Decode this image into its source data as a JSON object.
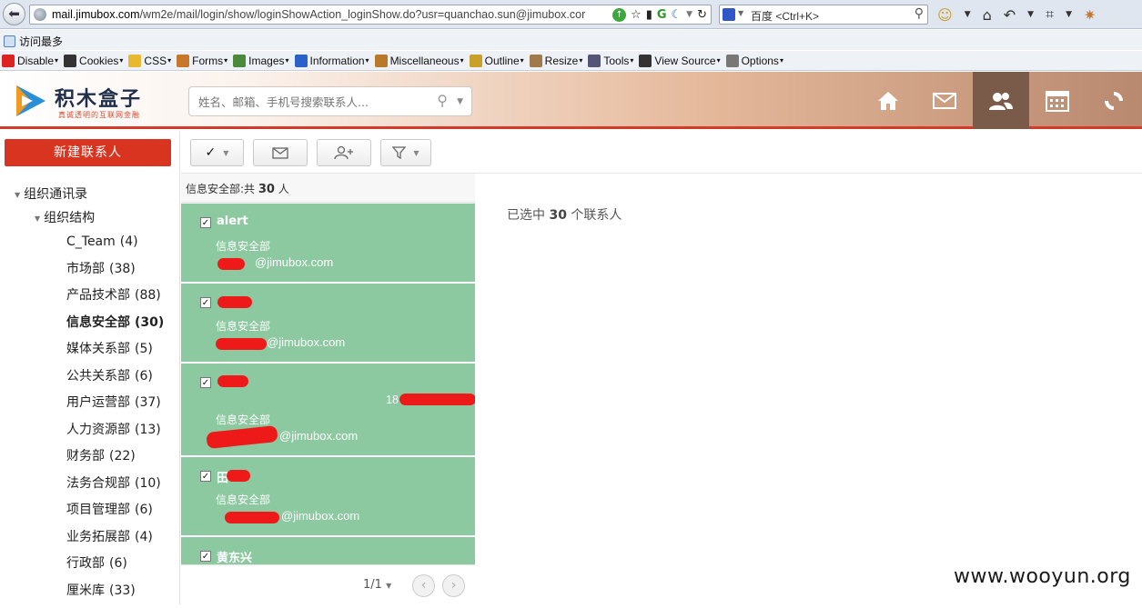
{
  "browser": {
    "url_host": "mail.jimubox.com",
    "url_path": "/wm2e/mail/login/show/loginShowAction_loginShow.do?usr=quanchao.sun@jimubox.cor",
    "search_placeholder": "百度 <Ctrl+K>",
    "bookmark": "访问最多",
    "devbar": [
      {
        "label": "Disable",
        "icon": "disable-icon",
        "color": "#d22"
      },
      {
        "label": "Cookies",
        "icon": "cookies-icon",
        "color": "#333"
      },
      {
        "label": "CSS",
        "icon": "css-icon",
        "color": "#e8b830"
      },
      {
        "label": "Forms",
        "icon": "forms-icon",
        "color": "#c8782a"
      },
      {
        "label": "Images",
        "icon": "images-icon",
        "color": "#4a8a3a"
      },
      {
        "label": "Information",
        "icon": "information-icon",
        "color": "#2a63c8"
      },
      {
        "label": "Miscellaneous",
        "icon": "miscellaneous-icon",
        "color": "#b87a2a"
      },
      {
        "label": "Outline",
        "icon": "outline-icon",
        "color": "#c8a02a"
      },
      {
        "label": "Resize",
        "icon": "resize-icon",
        "color": "#a07a4a"
      },
      {
        "label": "Tools",
        "icon": "tools-icon",
        "color": "#557"
      },
      {
        "label": "View Source",
        "icon": "view-source-icon",
        "color": "#333"
      },
      {
        "label": "Options",
        "icon": "options-icon",
        "color": "#777"
      }
    ]
  },
  "app": {
    "logo_title": "积木盒子",
    "logo_sub": "真诚透明的互联网金融",
    "search_placeholder": "姓名、邮箱、手机号搜索联系人...",
    "nav": [
      "home-icon",
      "mail-icon",
      "contacts-icon",
      "calendar-icon",
      "sync-icon"
    ],
    "accent": "#d9341f"
  },
  "sidebar": {
    "new_contact": "新建联系人",
    "root": "组织通讯录",
    "sub": "组织结构",
    "departments": [
      {
        "name": "C_Team",
        "count": "(4)",
        "active": false
      },
      {
        "name": "市场部",
        "count": "(38)",
        "active": false
      },
      {
        "name": "产品技术部",
        "count": "(88)",
        "active": false
      },
      {
        "name": "信息安全部",
        "count": "(30)",
        "active": true
      },
      {
        "name": "媒体关系部",
        "count": "(5)",
        "active": false
      },
      {
        "name": "公共关系部",
        "count": "(6)",
        "active": false
      },
      {
        "name": "用户运营部",
        "count": "(37)",
        "active": false
      },
      {
        "name": "人力资源部",
        "count": "(13)",
        "active": false
      },
      {
        "name": "财务部",
        "count": "(22)",
        "active": false
      },
      {
        "name": "法务合规部",
        "count": "(10)",
        "active": false
      },
      {
        "name": "项目管理部",
        "count": "(6)",
        "active": false
      },
      {
        "name": "业务拓展部",
        "count": "(4)",
        "active": false
      },
      {
        "name": "行政部",
        "count": "(6)",
        "active": false
      },
      {
        "name": "厘米库",
        "count": "(33)",
        "active": false
      }
    ]
  },
  "list": {
    "header_prefix": "信息安全部:共",
    "header_count": "30",
    "header_suffix": "人",
    "contacts": [
      {
        "name": "alert",
        "dept": "信息安全部",
        "email": "@jimubox.com",
        "phone": ""
      },
      {
        "name": "",
        "dept": "信息安全部",
        "email": "@jimubox.com",
        "phone": ""
      },
      {
        "name": "",
        "dept": "信息安全部",
        "email": "@jimubox.com",
        "phone": "18"
      },
      {
        "name": "田",
        "dept": "信息安全部",
        "email": "@jimubox.com",
        "phone": ""
      },
      {
        "name": "黄东兴",
        "dept": "",
        "email": "",
        "phone": ""
      }
    ],
    "pager": "1/1"
  },
  "detail": {
    "selected_prefix": "已选中",
    "selected_count": "30",
    "selected_suffix": "个联系人"
  },
  "watermark": "www.wooyun.org"
}
